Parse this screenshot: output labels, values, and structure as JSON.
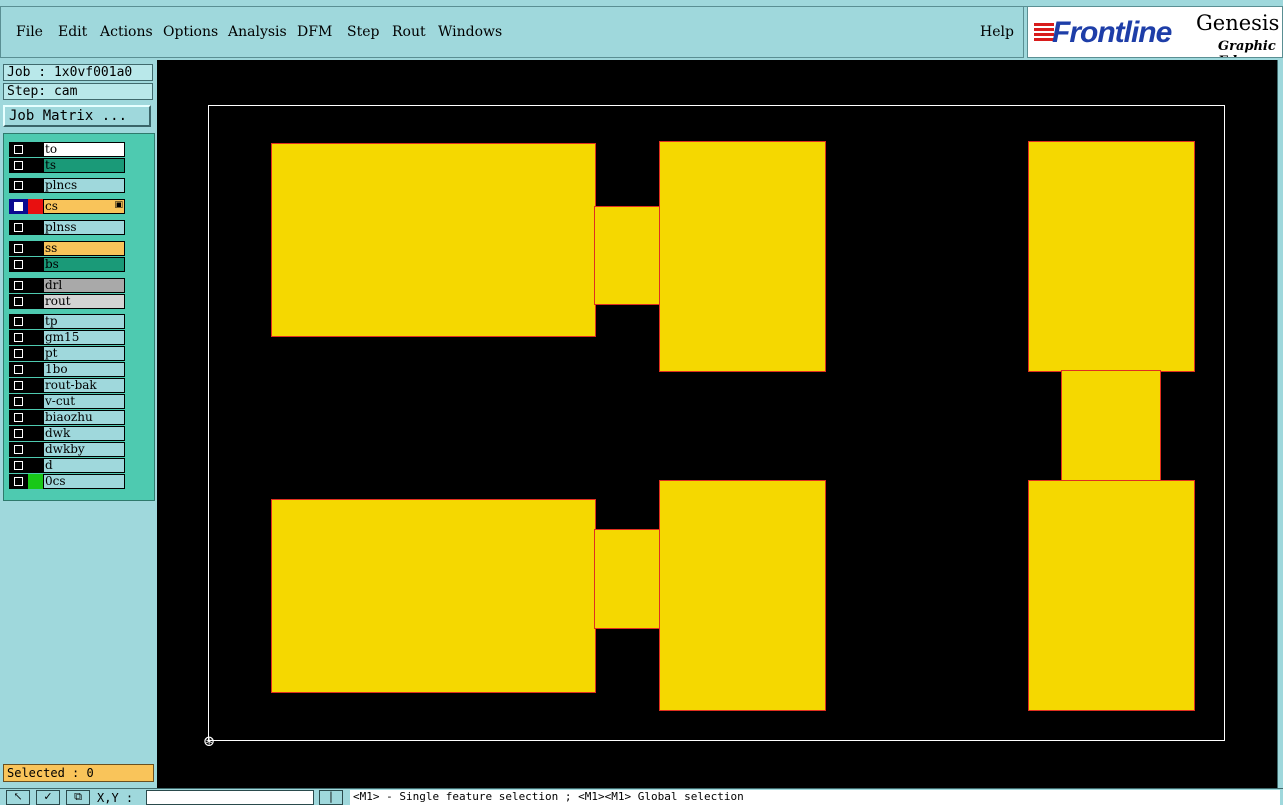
{
  "menu": {
    "items": [
      "File",
      "Edit",
      "Actions",
      "Options",
      "Analysis",
      "DFM",
      "Step",
      "Rout",
      "Windows"
    ],
    "help": "Help"
  },
  "logo": {
    "brand": "Frontline",
    "product": "Genesis",
    "subtitle": "Graphic Ed"
  },
  "sidebar": {
    "job": "Job : 1x0vf001a0",
    "step": "Step: cam",
    "matrix_button": "Job Matrix ...",
    "selected": "Selected : 0"
  },
  "layers": [
    {
      "name": "to",
      "color": "#ffffff",
      "clr": "#000000"
    },
    {
      "name": "ts",
      "color": "#1a9a78",
      "clr": "#000000"
    },
    {
      "name": "plncs",
      "color": "#9fd8dc",
      "clr": "#000000"
    },
    {
      "name": "cs",
      "color": "#f9c45a",
      "clr": "#e81010",
      "active": true
    },
    {
      "name": "plnss",
      "color": "#9fd8dc",
      "clr": "#000000"
    },
    {
      "name": "ss",
      "color": "#f9c45a",
      "clr": "#000000"
    },
    {
      "name": "bs",
      "color": "#1a9a78",
      "clr": "#000000"
    },
    {
      "name": "drl",
      "color": "#a9a9a9",
      "clr": "#000000"
    },
    {
      "name": "rout",
      "color": "#d4d4d4",
      "clr": "#000000"
    },
    {
      "name": "tp",
      "color": "#9fd8dc",
      "clr": "#000000"
    },
    {
      "name": "gm15",
      "color": "#9fd8dc",
      "clr": "#000000"
    },
    {
      "name": "pt",
      "color": "#9fd8dc",
      "clr": "#000000"
    },
    {
      "name": "1bo",
      "color": "#9fd8dc",
      "clr": "#000000"
    },
    {
      "name": "rout-bak",
      "color": "#9fd8dc",
      "clr": "#000000"
    },
    {
      "name": "v-cut",
      "color": "#9fd8dc",
      "clr": "#000000"
    },
    {
      "name": "biaozhu",
      "color": "#9fd8dc",
      "clr": "#000000"
    },
    {
      "name": "dwk",
      "color": "#9fd8dc",
      "clr": "#000000"
    },
    {
      "name": "dwkby",
      "color": "#9fd8dc",
      "clr": "#000000"
    },
    {
      "name": "d",
      "color": "#9fd8dc",
      "clr": "#000000"
    },
    {
      "name": "0cs",
      "color": "#9fd8dc",
      "clr": "#18c818"
    }
  ],
  "status": {
    "xy_label": "X,Y :",
    "message": "<M1> - Single feature selection ; <M1><M1> Global selection"
  },
  "colors": {
    "copper": "#f5d800",
    "canvas": "#000000",
    "outline": "#ffffff"
  }
}
